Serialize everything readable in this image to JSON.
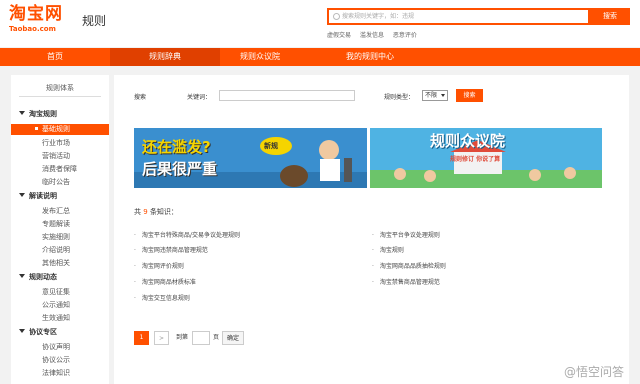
{
  "header": {
    "logo_cn": "淘宝网",
    "logo_en": "Taobao.com",
    "title": "规则",
    "search_placeholder": "搜索规则关键字，如：违规",
    "search_button": "搜索",
    "hot_links": [
      "虚假交易",
      "滥发信息",
      "恶意评价"
    ]
  },
  "nav": {
    "items": [
      {
        "label": "首页",
        "active": false
      },
      {
        "label": "规则辞典",
        "active": true
      },
      {
        "label": "规则众议院",
        "active": false
      },
      {
        "label": "我的规则中心",
        "active": false
      }
    ]
  },
  "sidebar": {
    "heading": "规则体系",
    "groups": [
      {
        "title": "淘宝规则",
        "items": [
          {
            "label": "基础规则",
            "active": true
          },
          {
            "label": "行业市场"
          },
          {
            "label": "营销活动"
          },
          {
            "label": "消费者保障"
          },
          {
            "label": "临时公告"
          }
        ]
      },
      {
        "title": "解读说明",
        "items": [
          {
            "label": "发布汇总"
          },
          {
            "label": "专题解读"
          },
          {
            "label": "实施细则"
          },
          {
            "label": "介绍说明"
          },
          {
            "label": "其他相关"
          }
        ]
      },
      {
        "title": "规则动态",
        "items": [
          {
            "label": "意见征集"
          },
          {
            "label": "公示通知"
          },
          {
            "label": "生效通知"
          }
        ]
      },
      {
        "title": "协议专区",
        "items": [
          {
            "label": "协议声明"
          },
          {
            "label": "协议公示"
          },
          {
            "label": "法律知识"
          }
        ]
      }
    ]
  },
  "filter": {
    "search_label": "搜索",
    "keyword_label": "关键词：",
    "keyword_value": "",
    "type_label": "规则类型：",
    "type_value": "不限",
    "button": "搜索"
  },
  "banners": {
    "left": {
      "line1": "还在滥发?",
      "line2": "后果很严重",
      "tag": "新规"
    },
    "right": {
      "title": "规则众议院",
      "subtitle": "规则修订 你说了算"
    }
  },
  "results": {
    "prefix": "共",
    "count": "9",
    "suffix": "条知识：",
    "items": [
      "淘宝平台特殊商品/交易争议处理规则",
      "淘宝平台争议处理规则",
      "淘宝网违禁商品管理规范",
      "淘宝规则",
      "淘宝网评价规则",
      "淘宝网商品品质抽检规则",
      "淘宝网商品材质标准",
      "淘宝禁售商品管理规范",
      "淘宝交互信息规则"
    ]
  },
  "pager": {
    "current": "1",
    "next": ">",
    "goto_label": "到第",
    "page_value": "",
    "page_unit": "页",
    "confirm": "确定"
  },
  "watermark": "@悟空问答",
  "colors": {
    "accent": "#ff5000",
    "nav_active": "#e04000"
  }
}
